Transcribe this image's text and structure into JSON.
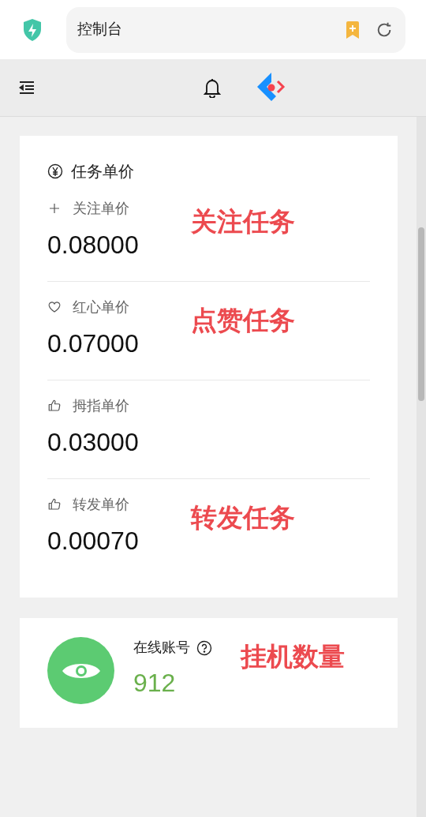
{
  "address_bar": {
    "title": "控制台"
  },
  "price_card": {
    "title": "任务单价",
    "items": [
      {
        "kind": "plus",
        "label": "关注单价",
        "value": "0.08000",
        "annotation": "关注任务"
      },
      {
        "kind": "heart",
        "label": "红心单价",
        "value": "0.07000",
        "annotation": "点赞任务"
      },
      {
        "kind": "thumb",
        "label": "拇指单价",
        "value": "0.03000"
      },
      {
        "kind": "thumb",
        "label": "转发单价",
        "value": "0.00070",
        "annotation": "转发任务"
      }
    ]
  },
  "online_card": {
    "label": "在线账号",
    "value": "912",
    "annotation": "挂机数量"
  }
}
